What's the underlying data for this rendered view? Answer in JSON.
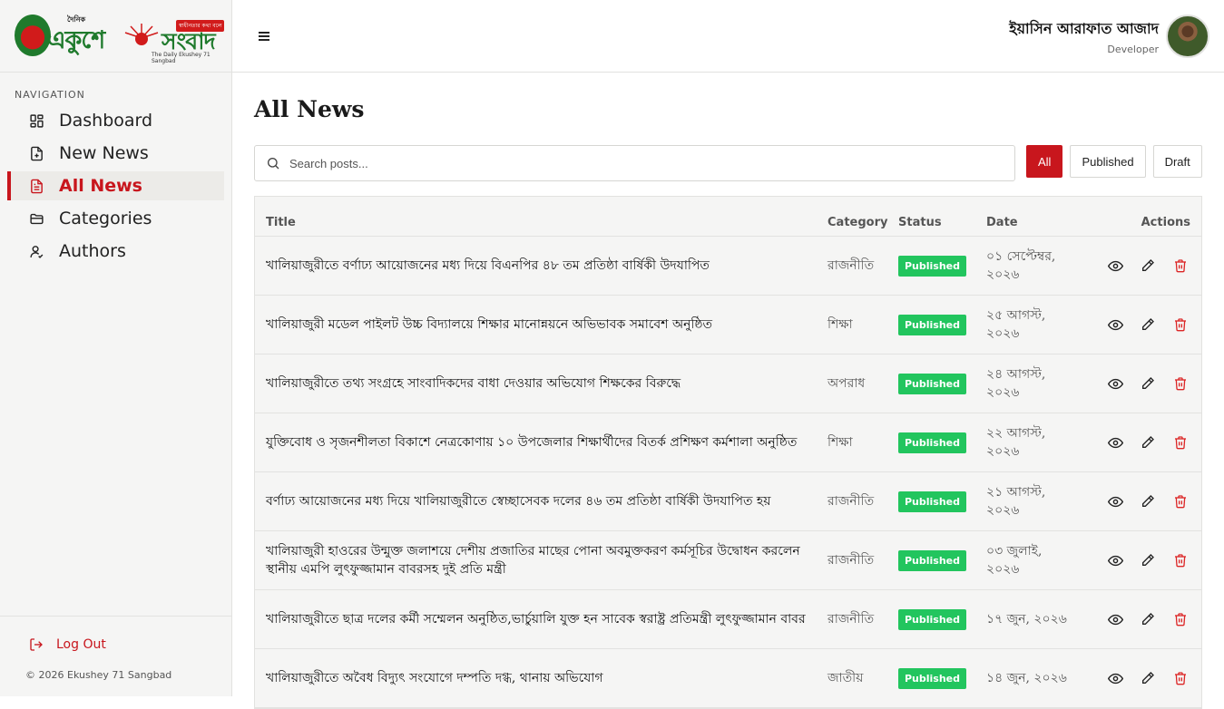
{
  "brand": {
    "small_top": "দৈনিক",
    "word1": "একুশে",
    "word2": "সংবাদ",
    "ribbon": "স্বাধীনতার কথা বলে",
    "tagline": "The Daily Ekushey 71 Sangbad"
  },
  "sidebar": {
    "nav_label": "NAVIGATION",
    "items": [
      {
        "label": "Dashboard",
        "icon": "dashboard-icon"
      },
      {
        "label": "New News",
        "icon": "file-plus-icon"
      },
      {
        "label": "All News",
        "icon": "file-text-icon",
        "active": true
      },
      {
        "label": "Categories",
        "icon": "folder-icon"
      },
      {
        "label": "Authors",
        "icon": "user-icon"
      }
    ],
    "logout_label": "Log Out",
    "copyright": "© 2026 Ekushey 71 Sangbad"
  },
  "header": {
    "user_name": "ইয়াসিন আরাফাত আজাদ",
    "user_role": "Developer"
  },
  "main": {
    "title": "All News",
    "search_placeholder": "Search posts...",
    "filters": [
      "All",
      "Published",
      "Draft"
    ],
    "active_filter": "All",
    "columns": {
      "title": "Title",
      "category": "Category",
      "status": "Status",
      "date": "Date",
      "actions": "Actions"
    },
    "rows": [
      {
        "title": "খালিয়াজুরীতে বর্ণাঢ্য আয়োজনের মধ্য দিয়ে বিএনপির ৪৮ তম প্রতিষ্ঠা বার্ষিকী উদযাপিত",
        "category": "রাজনীতি",
        "status": "Published",
        "date": "০১ সেপ্টেম্বর, ২০২৬"
      },
      {
        "title": "খালিয়াজুরী মডেল পাইলট উচ্চ বিদ্যালয়ে শিক্ষার মানোন্নয়নে অভিভাবক সমাবেশ অনুষ্ঠিত",
        "category": "শিক্ষা",
        "status": "Published",
        "date": "২৫ আগস্ট, ২০২৬"
      },
      {
        "title": "খালিয়াজুরীতে তথ্য সংগ্রহে সাংবাদিকদের বাধা দেওয়ার অভিযোগ শিক্ষকের বিরুদ্ধে",
        "category": "অপরাধ",
        "status": "Published",
        "date": "২৪ আগস্ট, ২০২৬"
      },
      {
        "title": "যুক্তিবোধ ও সৃজনশীলতা বিকাশে নেত্রকোণায় ১০ উপজেলার শিক্ষার্থীদের বিতর্ক প্রশিক্ষণ কর্মশালা অনুষ্ঠিত",
        "category": "শিক্ষা",
        "status": "Published",
        "date": "২২ আগস্ট, ২০২৬"
      },
      {
        "title": "বর্ণাঢ্য আয়োজনের মধ্য দিয়ে খালিয়াজুরীতে স্বেচ্ছাসেবক দলের ৪৬ তম প্রতিষ্ঠা বার্ষিকী উদযাপিত হয়",
        "category": "রাজনীতি",
        "status": "Published",
        "date": "২১ আগস্ট, ২০২৬"
      },
      {
        "title": "খালিয়াজুরী হাওরের উন্মুক্ত জলাশয়ে দেশীয় প্রজাতির মাছের পোনা অবমুক্তকরণ কর্মসূচির উদ্বোধন করলেন স্থানীয় এমপি লুৎফুজ্জামান বাবরসহ দুই প্রতি মন্ত্রী",
        "category": "রাজনীতি",
        "status": "Published",
        "date": "০৩ জুলাই, ২০২৬"
      },
      {
        "title": "খালিয়াজুরীতে ছাত্র দলের কর্মী সম্মেলন অনুষ্ঠিত,ভার্চুয়ালি যুক্ত হন সাবেক স্বরাষ্ট্র প্রতিমন্ত্রী লুৎফুজ্জামান বাবর",
        "category": "রাজনীতি",
        "status": "Published",
        "date": "১৭ জুন, ২০২৬"
      },
      {
        "title": "খালিয়াজুরীতে অবৈধ বিদ্যুৎ সংযোগে দম্পতি দগ্ধ, থানায় অভিযোগ",
        "category": "জাতীয়",
        "status": "Published",
        "date": "১৪ জুন, ২০২৬"
      }
    ]
  },
  "colors": {
    "accent": "#c8161d",
    "published": "#22c55e",
    "brand_green": "#1f7a2c"
  }
}
